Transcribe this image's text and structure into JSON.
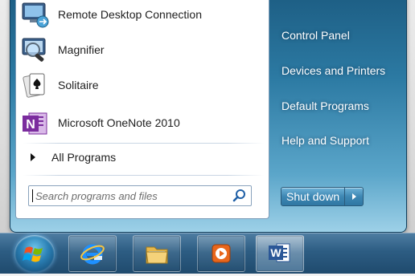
{
  "start_menu": {
    "programs": [
      {
        "label": "Remote Desktop Connection",
        "icon": "remote-desktop-icon"
      },
      {
        "label": "Magnifier",
        "icon": "magnifier-icon"
      },
      {
        "label": "Solitaire",
        "icon": "solitaire-icon"
      },
      {
        "label": "Microsoft OneNote 2010",
        "icon": "onenote-icon"
      }
    ],
    "all_programs_label": "All Programs",
    "search_placeholder": "Search programs and files",
    "right_items": [
      {
        "label": "Control Panel"
      },
      {
        "label": "Devices and Printers"
      },
      {
        "label": "Default Programs"
      },
      {
        "label": "Help and Support"
      }
    ],
    "shutdown_label": "Shut down"
  },
  "taskbar": {
    "items": [
      {
        "icon": "start-orb-icon"
      },
      {
        "icon": "internet-explorer-icon"
      },
      {
        "icon": "windows-explorer-icon"
      },
      {
        "icon": "media-player-icon"
      },
      {
        "icon": "word-icon"
      }
    ]
  },
  "colors": {
    "menu_frame": "#2c7aa3",
    "taskbar": "#2d5d83",
    "onenote_purple": "#7b2c9e",
    "word_blue": "#2b5797"
  }
}
